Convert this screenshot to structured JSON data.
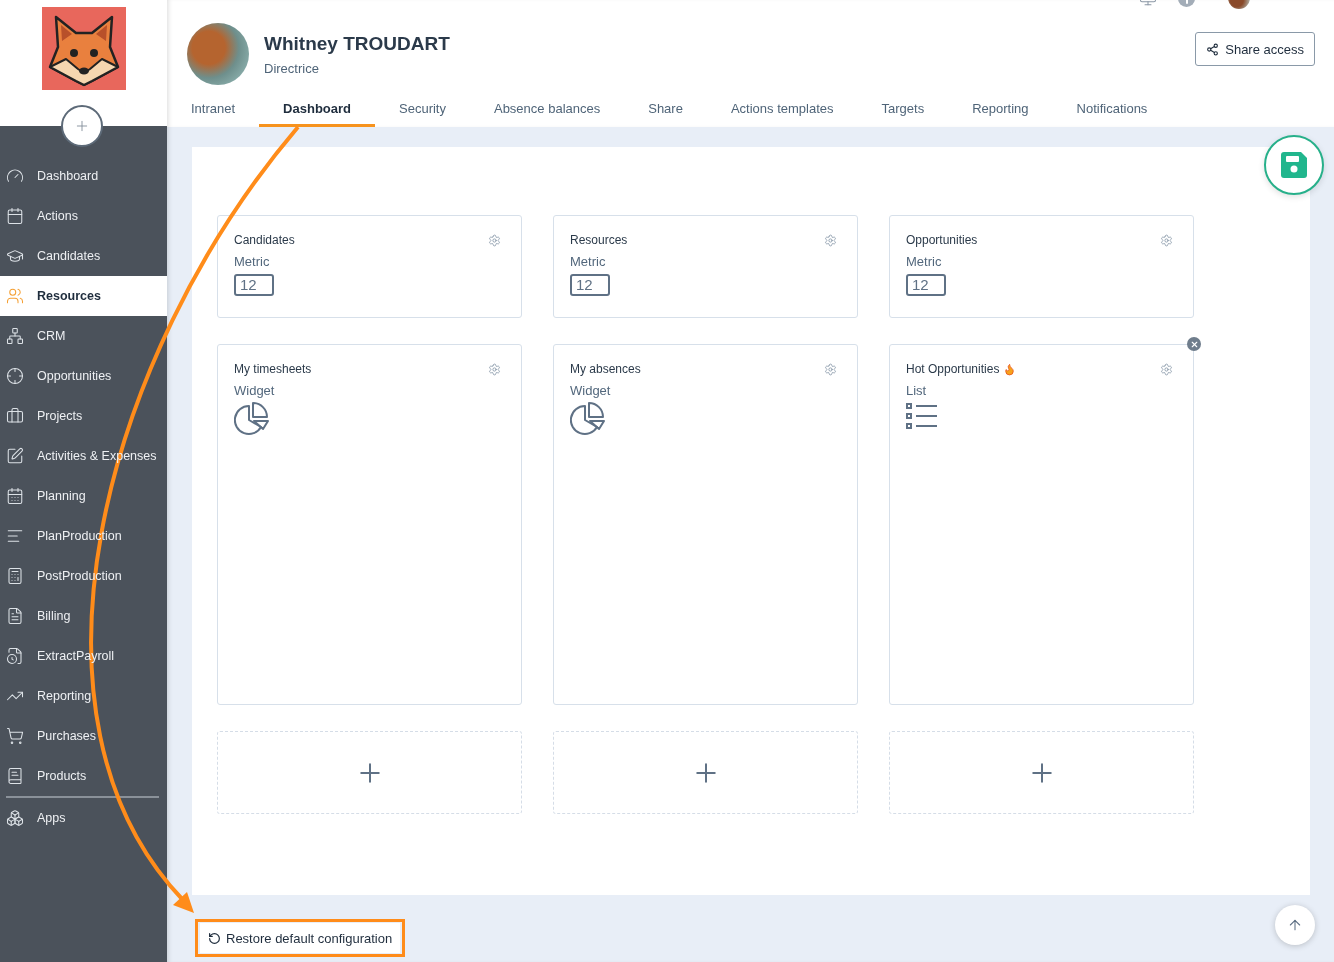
{
  "sidebar": {
    "items": [
      {
        "label": "Dashboard",
        "selected": false
      },
      {
        "label": "Actions",
        "selected": false
      },
      {
        "label": "Candidates",
        "selected": false
      },
      {
        "label": "Resources",
        "selected": true
      },
      {
        "label": "CRM",
        "selected": false
      },
      {
        "label": "Opportunities",
        "selected": false
      },
      {
        "label": "Projects",
        "selected": false
      },
      {
        "label": "Activities & Expenses",
        "selected": false
      },
      {
        "label": "Planning",
        "selected": false
      },
      {
        "label": "PlanProduction",
        "selected": false
      },
      {
        "label": "PostProduction",
        "selected": false
      },
      {
        "label": "Billing",
        "selected": false
      },
      {
        "label": "ExtractPayroll",
        "selected": false
      },
      {
        "label": "Reporting",
        "selected": false
      },
      {
        "label": "Purchases",
        "selected": false
      },
      {
        "label": "Products",
        "selected": false
      }
    ],
    "footer_items": [
      {
        "label": "Apps",
        "selected": false
      }
    ]
  },
  "profile": {
    "name": "Whitney TROUDART",
    "role": "Directrice"
  },
  "share_button": {
    "label": "Share access"
  },
  "tabs": [
    {
      "label": "Intranet",
      "selected": false
    },
    {
      "label": "Dashboard",
      "selected": true
    },
    {
      "label": "Security",
      "selected": false
    },
    {
      "label": "Absence balances",
      "selected": false
    },
    {
      "label": "Share",
      "selected": false
    },
    {
      "label": "Actions templates",
      "selected": false
    },
    {
      "label": "Targets",
      "selected": false
    },
    {
      "label": "Reporting",
      "selected": false
    },
    {
      "label": "Notifications",
      "selected": false
    }
  ],
  "cards": [
    {
      "kind": "metric",
      "title": "Candidates",
      "type_label": "Metric",
      "preview": "12",
      "hot": false,
      "removable": false
    },
    {
      "kind": "metric",
      "title": "Resources",
      "type_label": "Metric",
      "preview": "12",
      "hot": false,
      "removable": false
    },
    {
      "kind": "metric",
      "title": "Opportunities",
      "type_label": "Metric",
      "preview": "12",
      "hot": false,
      "removable": false
    },
    {
      "kind": "widget",
      "title": "My timesheets",
      "type_label": "Widget",
      "hot": false,
      "removable": false
    },
    {
      "kind": "widget",
      "title": "My absences",
      "type_label": "Widget",
      "hot": false,
      "removable": false
    },
    {
      "kind": "list",
      "title": "Hot Opportunities",
      "type_label": "List",
      "hot": true,
      "removable": true
    },
    {
      "kind": "add"
    },
    {
      "kind": "add"
    },
    {
      "kind": "add"
    }
  ],
  "restore_button": {
    "label": "Restore default configuration",
    "highlighted": true
  }
}
